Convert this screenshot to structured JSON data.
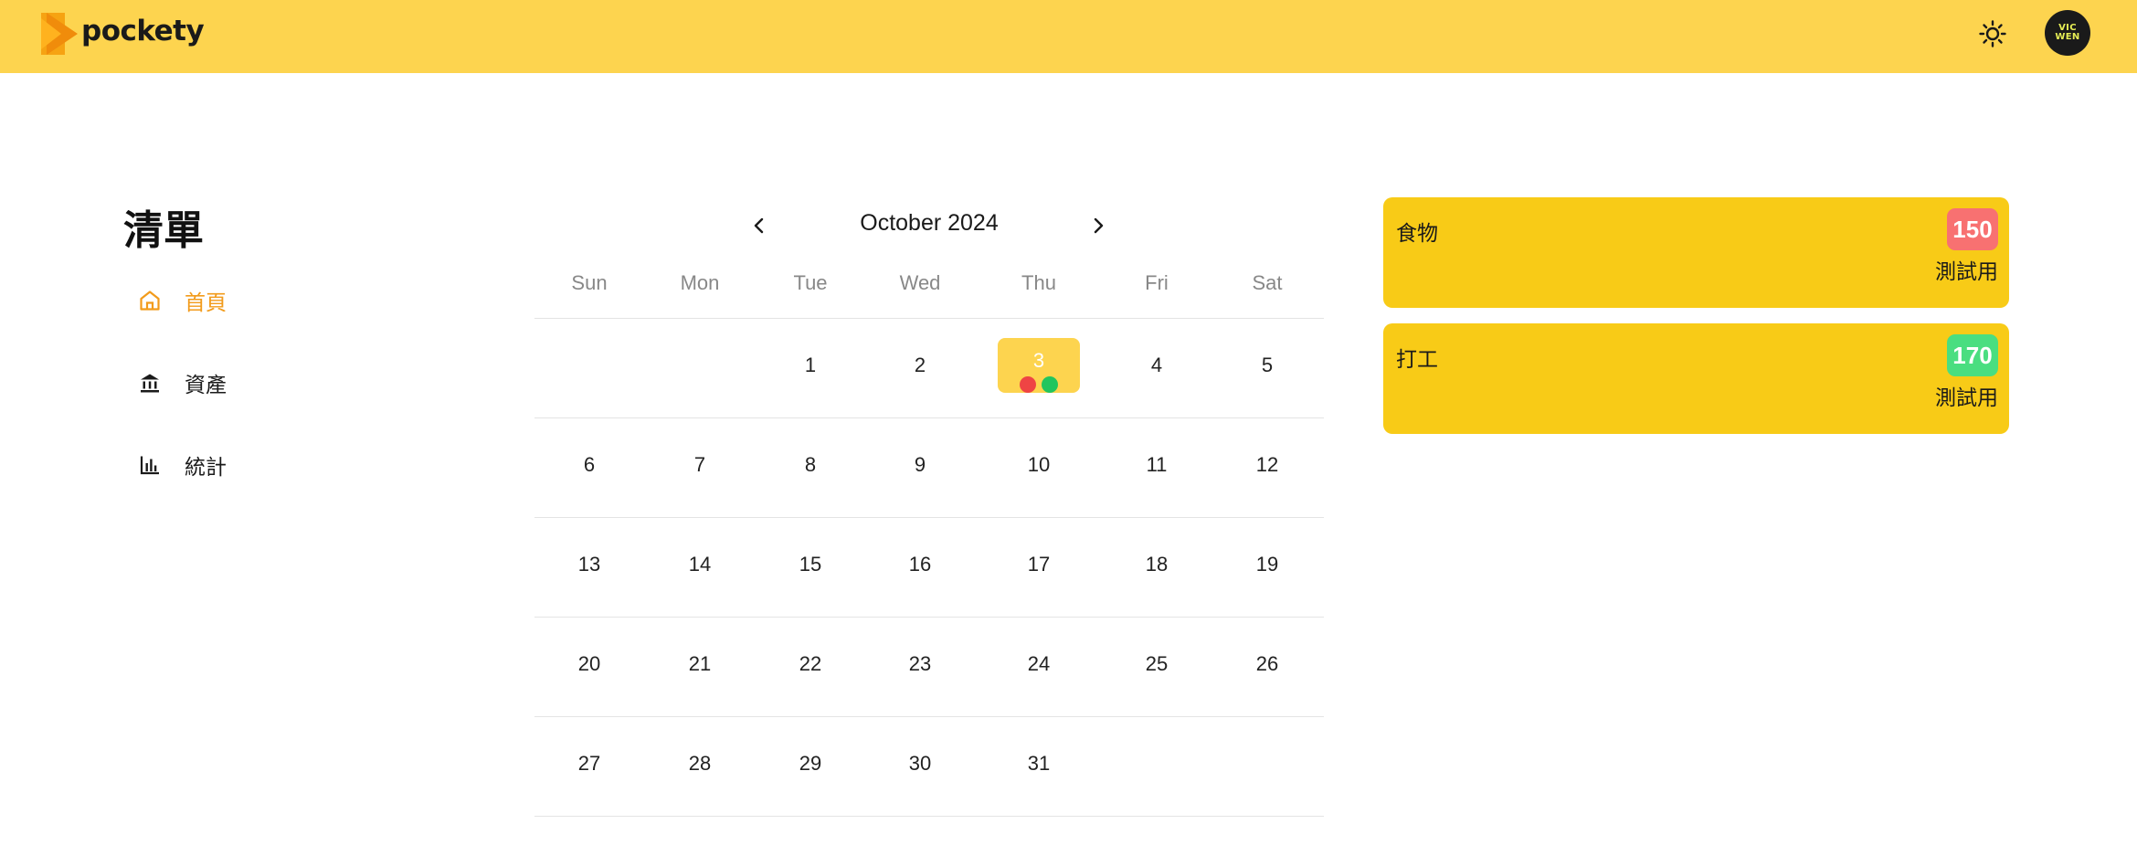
{
  "app": {
    "name": "pockety"
  },
  "header": {
    "theme_icon": "sun-icon",
    "avatar_line1": "VIC",
    "avatar_line2": "WEN",
    "colors": {
      "bar": "#fdd44f",
      "avatar_bg": "#1a1a1a",
      "avatar_text": "#e6ee55"
    }
  },
  "sidebar": {
    "title": "清單",
    "items": [
      {
        "label": "首頁",
        "icon": "home-icon",
        "active": true
      },
      {
        "label": "資產",
        "icon": "bank-icon",
        "active": false
      },
      {
        "label": "統計",
        "icon": "bar-chart-icon",
        "active": false
      }
    ],
    "active_color": "#f29b1b"
  },
  "calendar": {
    "month_label": "October 2024",
    "prev_icon": "chevron-left-icon",
    "next_icon": "chevron-right-icon",
    "weekdays": [
      "Sun",
      "Mon",
      "Tue",
      "Wed",
      "Thu",
      "Fri",
      "Sat"
    ],
    "first_weekday_index": 2,
    "days_in_month": 31,
    "selected_day": 3,
    "selected_day_markers": [
      "#ef4444",
      "#22c55e"
    ],
    "selected_color": "#fdd44f"
  },
  "entries": [
    {
      "category": "食物",
      "amount": "150",
      "note": "測試用",
      "badge_color": "#f87171"
    },
    {
      "category": "打工",
      "amount": "170",
      "note": "測試用",
      "badge_color": "#4ade80"
    }
  ]
}
